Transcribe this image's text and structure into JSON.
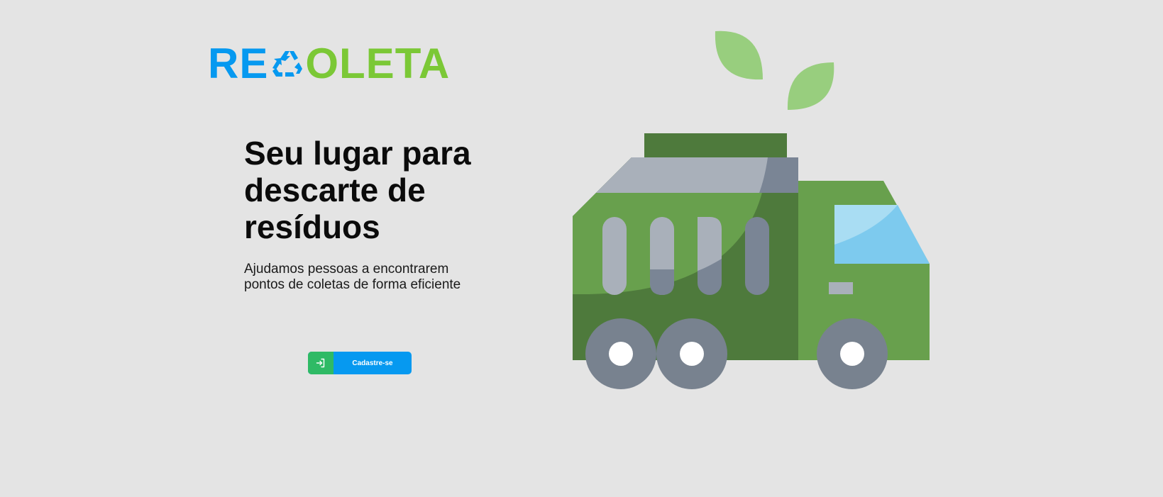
{
  "brand": {
    "logo_part1": "RE",
    "logo_part2": "OLETA",
    "logo_icon": "recycle-icon",
    "colors": {
      "blue": "#0699f0",
      "green": "#7bc836"
    }
  },
  "hero": {
    "headline_line1": "Seu lugar para",
    "headline_line2": "descarte de",
    "headline_line3": "resíduos",
    "subtitle_line1": "Ajudamos pessoas a encontrarem",
    "subtitle_line2": "pontos de coletas de forma eficiente"
  },
  "cta": {
    "signup_label": "Cadastre-se",
    "signup_icon": "sign-in-icon",
    "colors": {
      "icon_bg": "#2fba65",
      "button_bg": "#0699f0"
    }
  },
  "illustration": {
    "name": "garbage-truck-illustration",
    "colors": {
      "truck_dark": "#4e7a3c",
      "truck_light": "#68a04d",
      "wheel": "#78828f",
      "window": "#7dcaee",
      "leaf": "#98ce7e"
    }
  }
}
